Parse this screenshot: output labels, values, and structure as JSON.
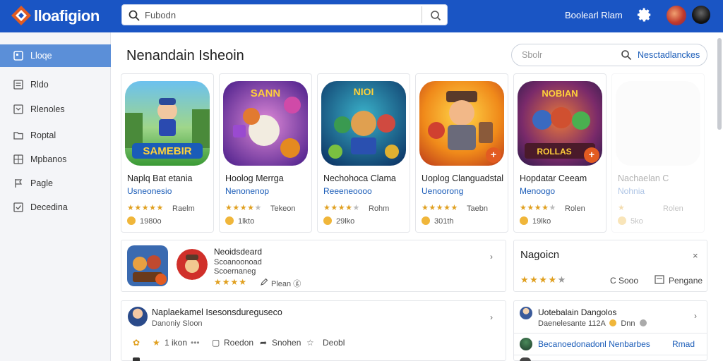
{
  "app": {
    "brand": "lloafigion"
  },
  "search": {
    "placeholder": "Fubodn"
  },
  "header": {
    "link": "Boolearl Rlam"
  },
  "sidebar": {
    "items": [
      {
        "label": "Lloqe",
        "icon": "home-icon",
        "active": true
      },
      {
        "label": "Rldo",
        "icon": "list-icon"
      },
      {
        "label": "Rlenoles",
        "icon": "inbox-icon"
      },
      {
        "label": "Roptal",
        "icon": "folder-icon"
      },
      {
        "label": "Mpbanos",
        "icon": "grid-icon"
      },
      {
        "label": "Pagle",
        "icon": "flag-icon"
      },
      {
        "label": "Decedina",
        "icon": "checkbox-icon"
      }
    ]
  },
  "main": {
    "title": "Nenandain Isheoin",
    "filter": {
      "placeholder": "Sbolr",
      "button": "Nesctadlanckes"
    },
    "cards": [
      {
        "title": "Naplq Bat etania",
        "dev": "Usneonesio",
        "rating": "Raelm",
        "downloads": "1980o"
      },
      {
        "title": "Hoolog Merrga",
        "dev": "Nenonenop",
        "rating": "Tekeon",
        "downloads": "1lkto"
      },
      {
        "title": "Nechohoca Clama",
        "dev": "Reeeneoooo",
        "rating": "Rohm",
        "downloads": "29lko"
      },
      {
        "title": "Uoplog Clanguadstal",
        "dev": "Uenoorong",
        "rating": "Taebn",
        "downloads": "301th"
      },
      {
        "title": "Hopdatar Ceeam",
        "dev": "Menoogo",
        "rating": "Rolen",
        "downloads": "19lko"
      },
      {
        "title": "Nachaelan C",
        "dev": "Nohnia",
        "rating": "Rolen",
        "downloads": "5ko"
      }
    ]
  },
  "panel_featured": {
    "title": "Neoidsdeard",
    "line2": "Scoanoonoad",
    "line3": "Scoernaneg",
    "stars": "★★★★",
    "pen_text": "Plean ⓖ"
  },
  "panel_reviews": {
    "title": "Nagoicn",
    "close": "×",
    "stars": "★★★★",
    "stars_grey": "★",
    "item1": "C Sooo",
    "item2": "Pengane"
  },
  "panel_post": {
    "title": "Naplaekamel Isesonsdureguseco",
    "subtitle": "Danoniy Sloon",
    "meta1": "1 ikon",
    "meta1_dots": "•••",
    "action1": "Roedon",
    "action2": "Snohen",
    "action3": "Deobl"
  },
  "panel_user": {
    "title": "Uotebalain Dangolos",
    "subtitle": "Daenelesante 112A",
    "subtitle2": "Dnn",
    "link": "Becanoedonadonl Nenbarbes",
    "link_action": "Rmad"
  },
  "colors": {
    "brand": "#1a55c4",
    "accent": "#5b8fd8",
    "link": "#1a5cb8",
    "star": "#e0a020",
    "plus_badge": "#e25b21"
  }
}
